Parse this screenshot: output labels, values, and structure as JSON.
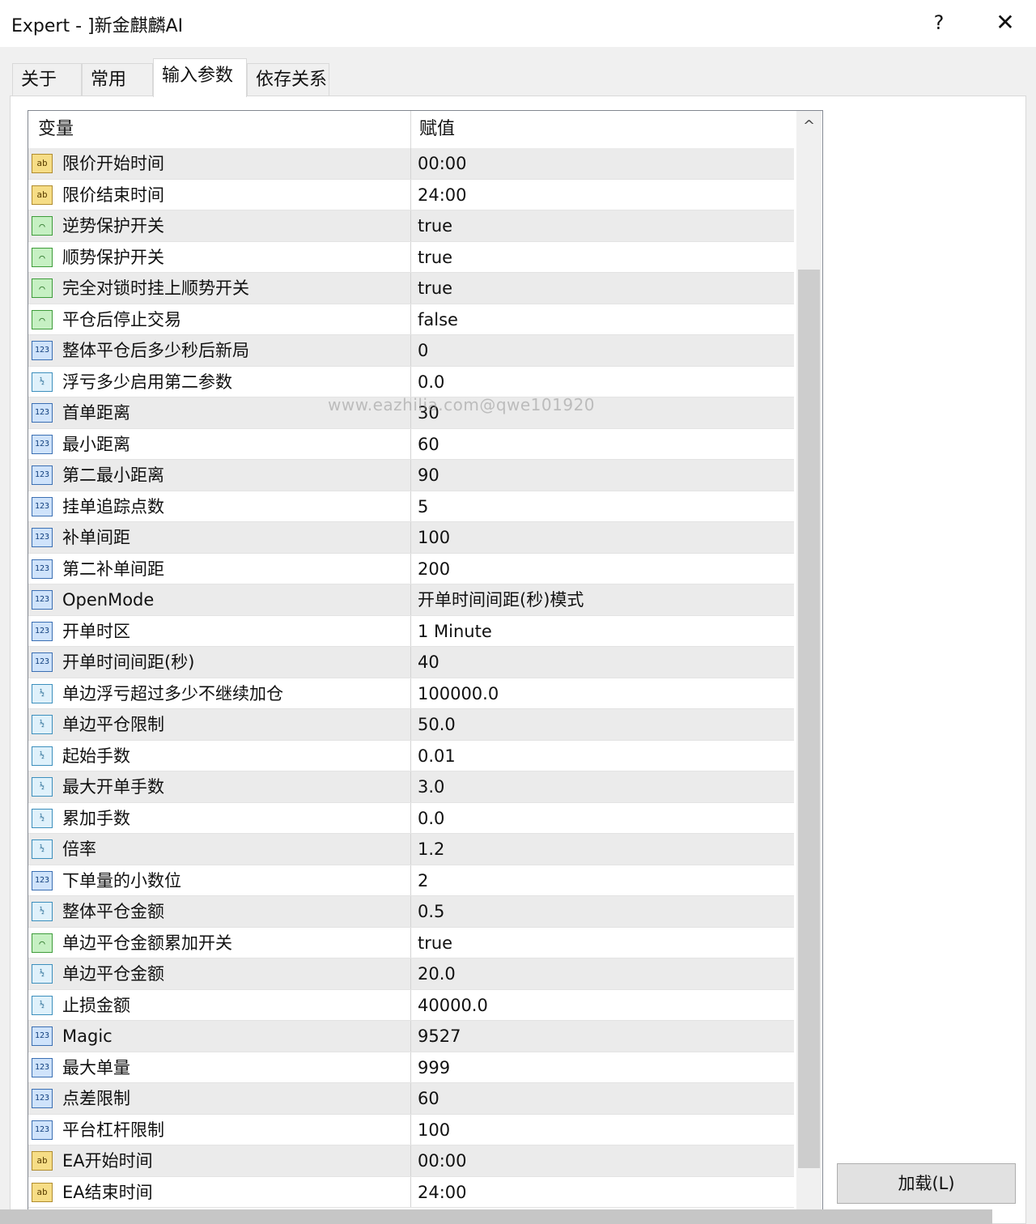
{
  "window": {
    "title": "Expert - ]新金麒麟AI",
    "help_label": "?",
    "close_label": "✕"
  },
  "tabs": [
    {
      "label": "关于",
      "active": false
    },
    {
      "label": "常用",
      "active": false
    },
    {
      "label": "输入参数",
      "active": true
    },
    {
      "label": "依存关系",
      "active": false
    }
  ],
  "grid": {
    "col_variable": "变量",
    "col_value": "赋值",
    "scroll_up_label": "^",
    "rows": [
      {
        "type": "ab",
        "name": "限价开始时间",
        "value": "00:00"
      },
      {
        "type": "ab",
        "name": "限价结束时间",
        "value": "24:00"
      },
      {
        "type": "bool",
        "name": "逆势保护开关",
        "value": "true"
      },
      {
        "type": "bool",
        "name": "顺势保护开关",
        "value": "true"
      },
      {
        "type": "bool",
        "name": "完全对锁时挂上顺势开关",
        "value": "true"
      },
      {
        "type": "bool",
        "name": "平仓后停止交易",
        "value": "false"
      },
      {
        "type": "num",
        "name": "整体平仓后多少秒后新局",
        "value": "0"
      },
      {
        "type": "dbl",
        "name": "浮亏多少启用第二参数",
        "value": "0.0"
      },
      {
        "type": "num",
        "name": "首单距离",
        "value": "30"
      },
      {
        "type": "num",
        "name": "最小距离",
        "value": "60"
      },
      {
        "type": "num",
        "name": "第二最小距离",
        "value": "90"
      },
      {
        "type": "num",
        "name": "挂单追踪点数",
        "value": "5"
      },
      {
        "type": "num",
        "name": "补单间距",
        "value": "100"
      },
      {
        "type": "num",
        "name": "第二补单间距",
        "value": "200"
      },
      {
        "type": "num",
        "name": "OpenMode",
        "value": "开单时间间距(秒)模式"
      },
      {
        "type": "num",
        "name": "开单时区",
        "value": "1 Minute"
      },
      {
        "type": "num",
        "name": "开单时间间距(秒)",
        "value": "40"
      },
      {
        "type": "dbl",
        "name": "单边浮亏超过多少不继续加仓",
        "value": "100000.0"
      },
      {
        "type": "dbl",
        "name": "单边平仓限制",
        "value": "50.0"
      },
      {
        "type": "dbl",
        "name": "起始手数",
        "value": "0.01"
      },
      {
        "type": "dbl",
        "name": "最大开单手数",
        "value": "3.0"
      },
      {
        "type": "dbl",
        "name": "累加手数",
        "value": "0.0"
      },
      {
        "type": "dbl",
        "name": "倍率",
        "value": "1.2"
      },
      {
        "type": "num",
        "name": "下单量的小数位",
        "value": "2"
      },
      {
        "type": "dbl",
        "name": "整体平仓金额",
        "value": "0.5"
      },
      {
        "type": "bool",
        "name": "单边平仓金额累加开关",
        "value": "true"
      },
      {
        "type": "dbl",
        "name": "单边平仓金额",
        "value": "20.0"
      },
      {
        "type": "dbl",
        "name": "止损金额",
        "value": "40000.0"
      },
      {
        "type": "num",
        "name": "Magic",
        "value": "9527"
      },
      {
        "type": "num",
        "name": "最大单量",
        "value": "999"
      },
      {
        "type": "num",
        "name": "点差限制",
        "value": "60"
      },
      {
        "type": "num",
        "name": "平台杠杆限制",
        "value": "100"
      },
      {
        "type": "ab",
        "name": "EA开始时间",
        "value": "00:00"
      },
      {
        "type": "ab",
        "name": "EA结束时间",
        "value": "24:00"
      }
    ]
  },
  "icon_glyphs": {
    "ab": "ab",
    "num": "123",
    "dbl": "½",
    "bool": "⌒"
  },
  "watermark": "www.eazhilia.com@qwe101920",
  "buttons": {
    "load": "加载(L)"
  }
}
